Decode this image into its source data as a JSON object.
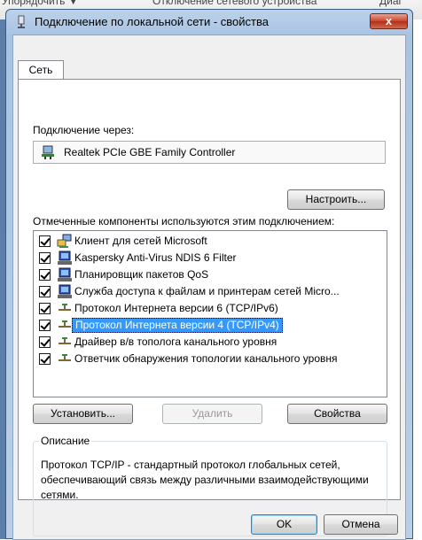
{
  "background": {
    "item1": "Упорядочить ▼",
    "item2": "Отключение сетевого устройства",
    "item3": "Диаг"
  },
  "window": {
    "title": "Подключение по локальной сети - свойства",
    "close_label": "x"
  },
  "tabs": [
    {
      "label": "Сеть"
    }
  ],
  "connect_via": {
    "label": "Подключение через:",
    "adapter": "Realtek PCIe GBE Family Controller",
    "configure_button": "Настроить..."
  },
  "components": {
    "label": "Отмеченные компоненты используются этим подключением:",
    "items": [
      {
        "label": "Клиент для сетей Microsoft",
        "checked": true,
        "icon": "network-client-icon"
      },
      {
        "label": "Kaspersky Anti-Virus NDIS 6 Filter",
        "checked": true,
        "icon": "service-icon"
      },
      {
        "label": "Планировщик пакетов QoS",
        "checked": true,
        "icon": "service-icon"
      },
      {
        "label": "Служба доступа к файлам и принтерам сетей Micro...",
        "checked": true,
        "icon": "service-icon"
      },
      {
        "label": "Протокол Интернета версии 6 (TCP/IPv6)",
        "checked": true,
        "icon": "protocol-icon"
      },
      {
        "label": "Протокол Интернета версии 4 (TCP/IPv4)",
        "checked": true,
        "icon": "protocol-icon",
        "selected": true
      },
      {
        "label": "Драйвер в/в тополога канального уровня",
        "checked": true,
        "icon": "protocol-icon"
      },
      {
        "label": "Ответчик обнаружения топологии канального уровня",
        "checked": true,
        "icon": "protocol-icon"
      }
    ]
  },
  "actions": {
    "install": "Установить...",
    "remove": "Удалить",
    "properties": "Свойства"
  },
  "description": {
    "legend": "Описание",
    "text": "Протокол TCP/IP - стандартный протокол глобальных сетей, обеспечивающий связь между различными взаимодействующими сетями."
  },
  "footer": {
    "ok": "OK",
    "cancel": "Отмена"
  },
  "colors": {
    "selection": "#3399ff",
    "title_gradient_top": "#bcd2ea"
  }
}
